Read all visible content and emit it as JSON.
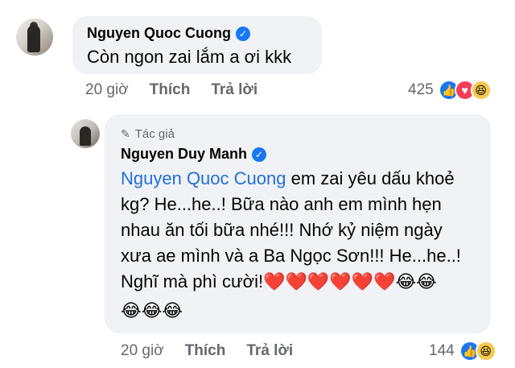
{
  "comment1": {
    "author": "Nguyen Quoc Cuong",
    "text": "Còn ngon zai lắm a ơi kkk",
    "time": "20 giờ",
    "like_label": "Thích",
    "reply_label": "Trả lời",
    "reaction_count": "425",
    "reactions": [
      "like",
      "love",
      "haha"
    ]
  },
  "comment2": {
    "badge": "Tác giả",
    "author": "Nguyen Duy Manh",
    "mention": "Nguyen Quoc Cuong",
    "line1_rest": " em zai yêu dấu khoẻ",
    "line2": "kg? He...he..! Bữa nào anh em mình hẹn",
    "line3": "nhau ăn tối bữa nhé!!! Nhớ kỷ niệm ngày",
    "line4": "xưa ae mình và a Ba Ngọc Sơn!!! He...he..!",
    "line5": "Nghĩ mà phì cười!",
    "emoji_line5": "❤️❤️❤️❤️❤️❤️😂😂",
    "emoji_line6": "😂😂😂",
    "time": "20 giờ",
    "like_label": "Thích",
    "reply_label": "Trả lời",
    "reaction_count": "144",
    "reactions": [
      "like",
      "haha"
    ]
  }
}
